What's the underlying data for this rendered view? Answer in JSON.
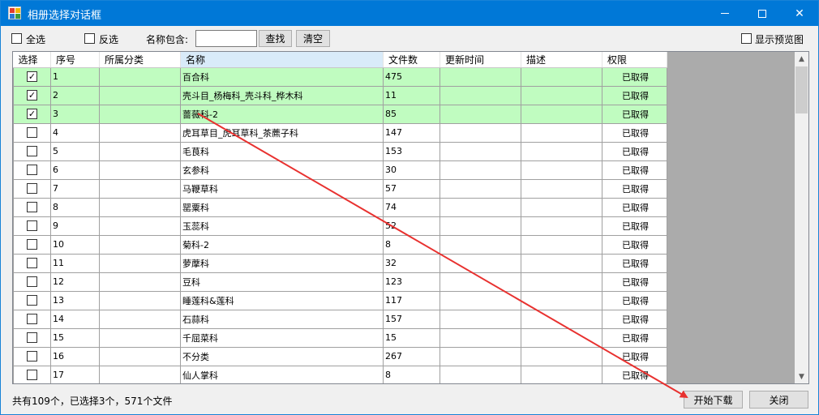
{
  "window": {
    "title": "相册选择对话框"
  },
  "toolbar": {
    "select_all_label": "全选",
    "invert_label": "反选",
    "name_contains_label": "名称包含:",
    "search_value": "",
    "find_label": "查找",
    "clear_label": "清空",
    "show_preview_label": "显示预览图"
  },
  "grid": {
    "headers": [
      "选择",
      "序号",
      "所属分类",
      "名称",
      "文件数",
      "更新时间",
      "描述",
      "权限"
    ],
    "rows": [
      {
        "checked": true,
        "index": "1",
        "category": "",
        "name": "百合科",
        "files": "475",
        "updated": "",
        "desc": "",
        "perm": "已取得"
      },
      {
        "checked": true,
        "index": "2",
        "category": "",
        "name": "壳斗目_杨梅科_壳斗科_桦木科",
        "files": "11",
        "updated": "",
        "desc": "",
        "perm": "已取得"
      },
      {
        "checked": true,
        "index": "3",
        "category": "",
        "name": "蔷薇科-2",
        "files": "85",
        "updated": "",
        "desc": "",
        "perm": "已取得"
      },
      {
        "checked": false,
        "index": "4",
        "category": "",
        "name": "虎耳草目_虎耳草科_茶藨子科",
        "files": "147",
        "updated": "",
        "desc": "",
        "perm": "已取得"
      },
      {
        "checked": false,
        "index": "5",
        "category": "",
        "name": "毛茛科",
        "files": "153",
        "updated": "",
        "desc": "",
        "perm": "已取得"
      },
      {
        "checked": false,
        "index": "6",
        "category": "",
        "name": "玄参科",
        "files": "30",
        "updated": "",
        "desc": "",
        "perm": "已取得"
      },
      {
        "checked": false,
        "index": "7",
        "category": "",
        "name": "马鞭草科",
        "files": "57",
        "updated": "",
        "desc": "",
        "perm": "已取得"
      },
      {
        "checked": false,
        "index": "8",
        "category": "",
        "name": "罂粟科",
        "files": "74",
        "updated": "",
        "desc": "",
        "perm": "已取得"
      },
      {
        "checked": false,
        "index": "9",
        "category": "",
        "name": "玉蕊科",
        "files": "52",
        "updated": "",
        "desc": "",
        "perm": "已取得"
      },
      {
        "checked": false,
        "index": "10",
        "category": "",
        "name": "菊科-2",
        "files": "8",
        "updated": "",
        "desc": "",
        "perm": "已取得"
      },
      {
        "checked": false,
        "index": "11",
        "category": "",
        "name": "萝藦科",
        "files": "32",
        "updated": "",
        "desc": "",
        "perm": "已取得"
      },
      {
        "checked": false,
        "index": "12",
        "category": "",
        "name": "豆科",
        "files": "123",
        "updated": "",
        "desc": "",
        "perm": "已取得"
      },
      {
        "checked": false,
        "index": "13",
        "category": "",
        "name": "睡莲科&莲科",
        "files": "117",
        "updated": "",
        "desc": "",
        "perm": "已取得"
      },
      {
        "checked": false,
        "index": "14",
        "category": "",
        "name": "石蒜科",
        "files": "157",
        "updated": "",
        "desc": "",
        "perm": "已取得"
      },
      {
        "checked": false,
        "index": "15",
        "category": "",
        "name": "千屈菜科",
        "files": "15",
        "updated": "",
        "desc": "",
        "perm": "已取得"
      },
      {
        "checked": false,
        "index": "16",
        "category": "",
        "name": "不分类",
        "files": "267",
        "updated": "",
        "desc": "",
        "perm": "已取得"
      },
      {
        "checked": false,
        "index": "17",
        "category": "",
        "name": "仙人掌科",
        "files": "8",
        "updated": "",
        "desc": "",
        "perm": "已取得"
      }
    ]
  },
  "status": {
    "summary": "共有109个，已选择3个，571个文件"
  },
  "footer": {
    "start_download_label": "开始下载",
    "close_label": "关闭"
  },
  "colors": {
    "accent": "#0078d7",
    "selected_row": "#c0fcc0",
    "arrow": "#e8312f"
  },
  "icons": {
    "check": "check-icon"
  }
}
